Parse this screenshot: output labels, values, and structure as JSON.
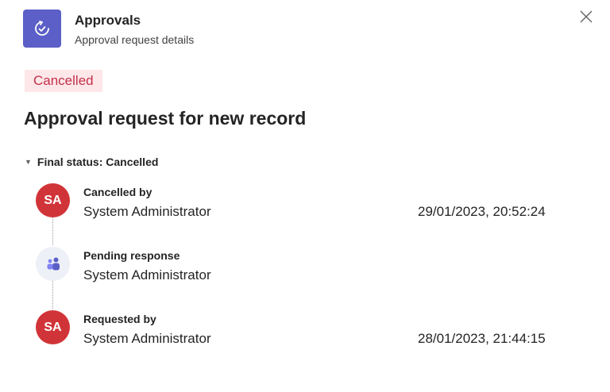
{
  "header": {
    "app_name": "Approvals",
    "subtitle": "Approval request details",
    "app_icon": "approvals-icon",
    "close_icon": "close-icon",
    "accent_color": "#5b5fc7"
  },
  "status_badge": {
    "label": "Cancelled",
    "bg_color": "#fde7e9",
    "text_color": "#c4314b"
  },
  "request": {
    "title": "Approval request for new record"
  },
  "final_status": {
    "label": "Final status: Cancelled",
    "expanded": true
  },
  "timeline": [
    {
      "avatar_initials": "SA",
      "avatar_color": "#d13438",
      "label": "Cancelled by",
      "name": "System Administrator",
      "timestamp": "29/01/2023, 20:52:24"
    },
    {
      "avatar_icon": "teams-icon",
      "label": "Pending response",
      "name": "System Administrator",
      "timestamp": ""
    },
    {
      "avatar_initials": "SA",
      "avatar_color": "#d13438",
      "label": "Requested by",
      "name": "System Administrator",
      "timestamp": "28/01/2023, 21:44:15"
    }
  ]
}
